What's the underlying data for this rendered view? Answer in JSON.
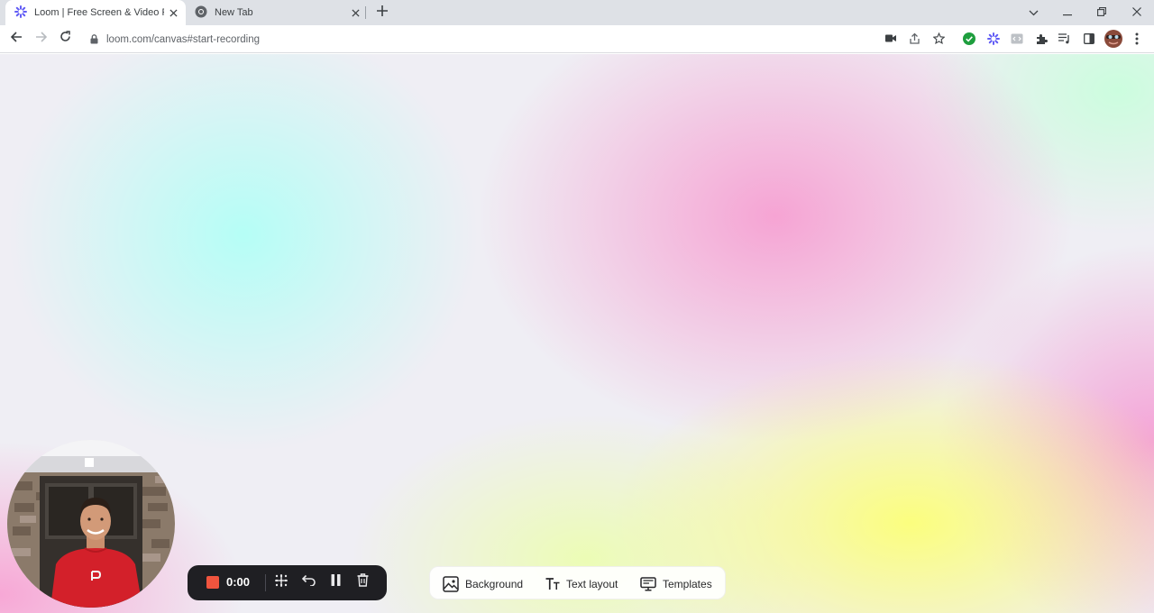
{
  "browser": {
    "tabs": [
      {
        "title": "Loom | Free Screen & Video Reco",
        "icon": "loom-icon",
        "active": true
      },
      {
        "title": "New Tab",
        "icon": "chrome-icon",
        "active": false
      }
    ],
    "url": "loom.com/canvas#start-recording",
    "extensions": [
      "green-check-icon",
      "loom-icon",
      "devtools-icon",
      "puzzle-icon",
      "media-icon",
      "sidepanel-icon",
      "avatar"
    ]
  },
  "recording": {
    "time": "0:00",
    "stop_color": "#f0543e"
  },
  "canvas_toolbar": {
    "background_label": "Background",
    "text_layout_label": "Text layout",
    "templates_label": "Templates"
  },
  "colors": {
    "tabstrip": "#dee1e6",
    "recbar": "#1f1f23",
    "cyan": "#b2fff6",
    "pink": "#f6a0d2",
    "yellow": "#fcff78"
  }
}
